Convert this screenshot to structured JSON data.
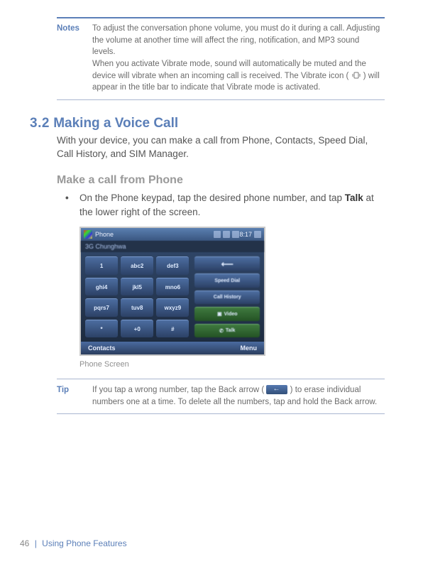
{
  "notes": {
    "label": "Notes",
    "text1": "To adjust the conversation phone volume, you must do it during a call. Adjusting the volume at another time will affect the ring, notification, and MP3 sound levels.",
    "text2a": "When you activate Vibrate mode, sound will automatically be muted and the device will vibrate when an incoming call is received. The Vibrate icon (",
    "text2b": ") will appear in the title bar to indicate that Vibrate mode is activated."
  },
  "section": {
    "number": "3.2",
    "title": "Making a Voice Call",
    "intro": "With your device, you can make a call from Phone, Contacts, Speed Dial, Call History, and SIM Manager."
  },
  "sub": {
    "heading": "Make a call from Phone",
    "bullet_pre": "On the Phone keypad, tap the desired phone number, and tap ",
    "bullet_strong": "Talk",
    "bullet_post": " at the lower right of the screen."
  },
  "phone": {
    "title": "Phone",
    "clock": "8:17",
    "operator": "3G Chunghwa",
    "keys": [
      "1",
      "abc2",
      "def3",
      "ghi4",
      "jkl5",
      "mno6",
      "pqrs7",
      "tuv8",
      "wxyz9",
      "*",
      "+0",
      "#"
    ],
    "side": {
      "back": "⟵",
      "speed": "Speed Dial",
      "history": "Call History",
      "video": "Video",
      "talk": "Talk"
    },
    "soft_left": "Contacts",
    "soft_right": "Menu",
    "caption": "Phone Screen"
  },
  "tip": {
    "label": "Tip",
    "text_a": "If you tap a wrong number, tap the Back arrow (",
    "text_b": ") to erase individual numbers one at a time. To delete all the numbers, tap and hold the Back arrow."
  },
  "footer": {
    "page": "46",
    "separator": "|",
    "chapter": "Using Phone Features"
  }
}
